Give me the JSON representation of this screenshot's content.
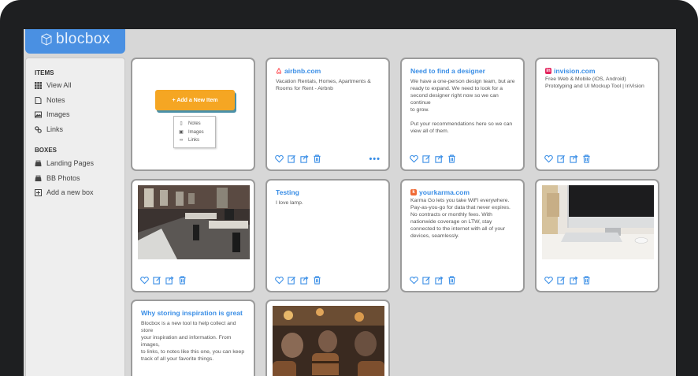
{
  "app": {
    "logo_text": "blocbox",
    "accent": "#4a90e2"
  },
  "sidebar": {
    "items_title": "ITEMS",
    "items": [
      {
        "label": "View All",
        "icon": "grid-icon"
      },
      {
        "label": "Notes",
        "icon": "note-icon"
      },
      {
        "label": "Images",
        "icon": "image-icon"
      },
      {
        "label": "Links",
        "icon": "link-icon"
      }
    ],
    "boxes_title": "BOXES",
    "boxes": [
      {
        "label": "Landing Pages",
        "icon": "box-icon"
      },
      {
        "label": "BB Photos",
        "icon": "box-icon"
      },
      {
        "label": "Add a new box",
        "icon": "plus-square-icon"
      }
    ]
  },
  "add_card": {
    "button_label": "+ Add a New Item",
    "button_color": "#f5a623",
    "menu": [
      {
        "label": "Notes",
        "icon": "note-icon"
      },
      {
        "label": "Images",
        "icon": "image-icon"
      },
      {
        "label": "Links",
        "icon": "link-icon"
      }
    ]
  },
  "cards": {
    "airbnb": {
      "title": "airbnb.com",
      "text": "Vacation Rentals, Homes, Apartments &\nRooms for Rent - Airbnb",
      "more": "•••"
    },
    "designer": {
      "title": "Need to find a designer",
      "text": "We have a one-person design team, but are\nready to expand. We need to look for a\nsecond designer right now so we can continue\nto grow.\n\nPut your recommendations here so we can\nview all of them."
    },
    "invision": {
      "title": "invision.com",
      "text": "Free Web & Mobile (iOS, Android)\nPrototyping and UI Mockup Tool | InVision"
    },
    "testing": {
      "title": "Testing",
      "text": "I love lamp."
    },
    "yourkarma": {
      "title": "yourkarma.com",
      "text": "Karma Go lets you take WiFi everywhere.\nPay-as-you-go for data that never expires.\nNo contracts or monthly fees. With\nnationwide coverage on LTW, stay\nconnected to the internet with all of your\ndevices, seamlessly."
    },
    "inspiration": {
      "title": "Why storing inspiration is great",
      "text": "Blocbox is a new tool to help collect and store\nyour inspiration and information. From images,\nto links, to notes like this one, you can keep\ntrack of all your favorite things."
    }
  },
  "action_icons": [
    "heart-icon",
    "edit-icon",
    "share-icon",
    "trash-icon"
  ]
}
